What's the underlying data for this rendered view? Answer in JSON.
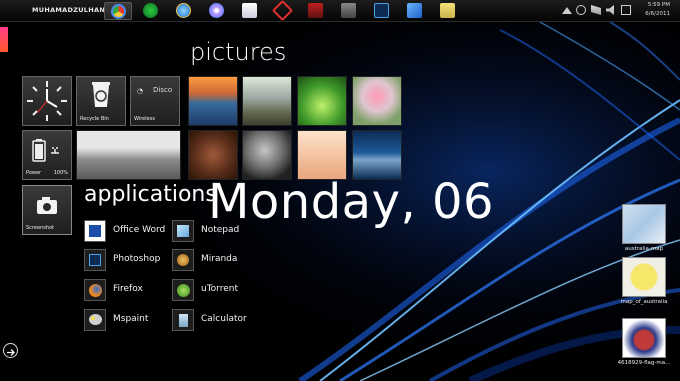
{
  "taskbar": {
    "username": "MUHAMADZULHANIF",
    "clock_time": "5:59 PM",
    "clock_date": "6/6/2011",
    "icons": [
      "chrome-icon",
      "media-center-icon",
      "internet-explorer-icon",
      "dvd-player-icon",
      "windows-live-icon",
      "game-icon",
      "video-icon",
      "media-player-icon",
      "photoshop-icon",
      "network-icon",
      "notes-icon"
    ]
  },
  "headings": {
    "pictures": "pictures",
    "applications": "applications",
    "date": "Monday, 06"
  },
  "tiles": {
    "recycle_bin": "Recycle Bin",
    "wireless": "Wireless",
    "wireless_ssid": "Disco",
    "power": "Power",
    "power_level": "100%",
    "screenshot": "Screenshot"
  },
  "apps": [
    {
      "label": "Office Word",
      "icon": "word-icon"
    },
    {
      "label": "Notepad",
      "icon": "notepad-icon"
    },
    {
      "label": "Photoshop",
      "icon": "photoshop-icon"
    },
    {
      "label": "Miranda",
      "icon": "miranda-icon"
    },
    {
      "label": "Firefox",
      "icon": "firefox-icon"
    },
    {
      "label": "uTorrent",
      "icon": "utorrent-icon"
    },
    {
      "label": "Mspaint",
      "icon": "paint-icon"
    },
    {
      "label": "Calculator",
      "icon": "calculator-icon"
    }
  ],
  "desktop": [
    {
      "label": "australia-map"
    },
    {
      "label": "map_of_australia"
    },
    {
      "label": "4618929-flag-ma..."
    }
  ],
  "colors": {
    "accent": "#ff3c8a",
    "streak": "#2a8cff"
  }
}
